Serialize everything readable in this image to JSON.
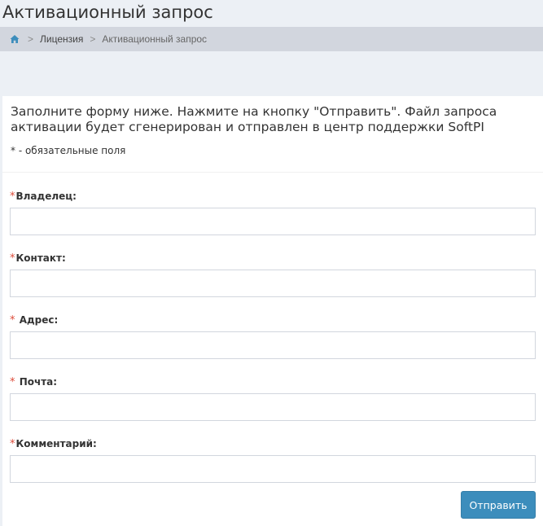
{
  "page": {
    "title": "Активационный запрос"
  },
  "breadcrumb": {
    "home_icon": "home-icon",
    "separator": ">",
    "items": [
      {
        "label": "Лицензия"
      },
      {
        "label": "Активационный запрос"
      }
    ]
  },
  "form": {
    "intro": "Заполните форму ниже. Нажмите на кнопку \"Отправить\". Файл запроса активации будет сгенерирован и отправлен в центр поддержки SoftPI",
    "required_note": "* - обязательные поля",
    "required_marker": "*",
    "fields": [
      {
        "label": "Владелец:",
        "value": "",
        "placeholder": ""
      },
      {
        "label": "Контакт:",
        "value": "",
        "placeholder": ""
      },
      {
        "label": "Адрес:",
        "value": "",
        "placeholder": ""
      },
      {
        "label": "Почта:",
        "value": "",
        "placeholder": ""
      },
      {
        "label": "Комментарий:",
        "value": "",
        "placeholder": ""
      }
    ],
    "submit_label": "Отправить"
  },
  "colors": {
    "accent": "#3c8dbc",
    "required": "#dd4b39",
    "breadcrumb_bg": "#d2d6de",
    "page_bg": "#ecf0f5"
  }
}
